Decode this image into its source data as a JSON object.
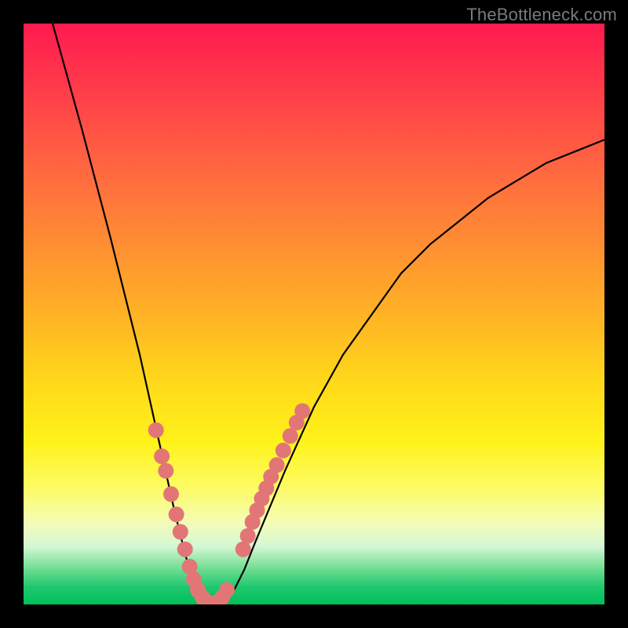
{
  "watermark": "TheBottleneck.com",
  "chart_data": {
    "type": "line",
    "title": "",
    "xlabel": "",
    "ylabel": "",
    "xlim": [
      0,
      100
    ],
    "ylim": [
      0,
      100
    ],
    "grid": false,
    "legend": false,
    "series": [
      {
        "name": "bottleneck-curve",
        "x": [
          5,
          10,
          15,
          20,
          22,
          24,
          26,
          28,
          30,
          32,
          34,
          36,
          38,
          40,
          45,
          50,
          55,
          60,
          65,
          70,
          75,
          80,
          85,
          90,
          95,
          100
        ],
        "y": [
          100,
          82,
          63,
          43,
          34,
          25,
          16,
          8,
          3,
          0,
          0,
          2,
          6,
          11,
          23,
          34,
          43,
          50,
          57,
          62,
          66,
          70,
          73,
          76,
          78,
          80
        ]
      }
    ],
    "markers": {
      "name": "highlight-dots",
      "radius": 10,
      "color": "#e27676",
      "points_xy": [
        [
          22.8,
          30
        ],
        [
          23.8,
          25.5
        ],
        [
          24.5,
          23
        ],
        [
          25.4,
          19
        ],
        [
          26.3,
          15.5
        ],
        [
          27.0,
          12.5
        ],
        [
          27.8,
          9.5
        ],
        [
          28.6,
          6.5
        ],
        [
          29.3,
          4.3
        ],
        [
          30.0,
          2.5
        ],
        [
          30.8,
          1.2
        ],
        [
          31.6,
          0.4
        ],
        [
          32.5,
          0
        ],
        [
          33.4,
          0.4
        ],
        [
          34.2,
          1.2
        ],
        [
          35.0,
          2.5
        ],
        [
          37.8,
          9.5
        ],
        [
          38.6,
          11.8
        ],
        [
          39.4,
          14.2
        ],
        [
          40.2,
          16.2
        ],
        [
          41.0,
          18.2
        ],
        [
          41.8,
          20.0
        ],
        [
          42.6,
          22.0
        ],
        [
          43.6,
          24.0
        ],
        [
          44.7,
          26.5
        ],
        [
          45.9,
          29.0
        ],
        [
          47.0,
          31.3
        ],
        [
          48.0,
          33.3
        ]
      ]
    }
  }
}
